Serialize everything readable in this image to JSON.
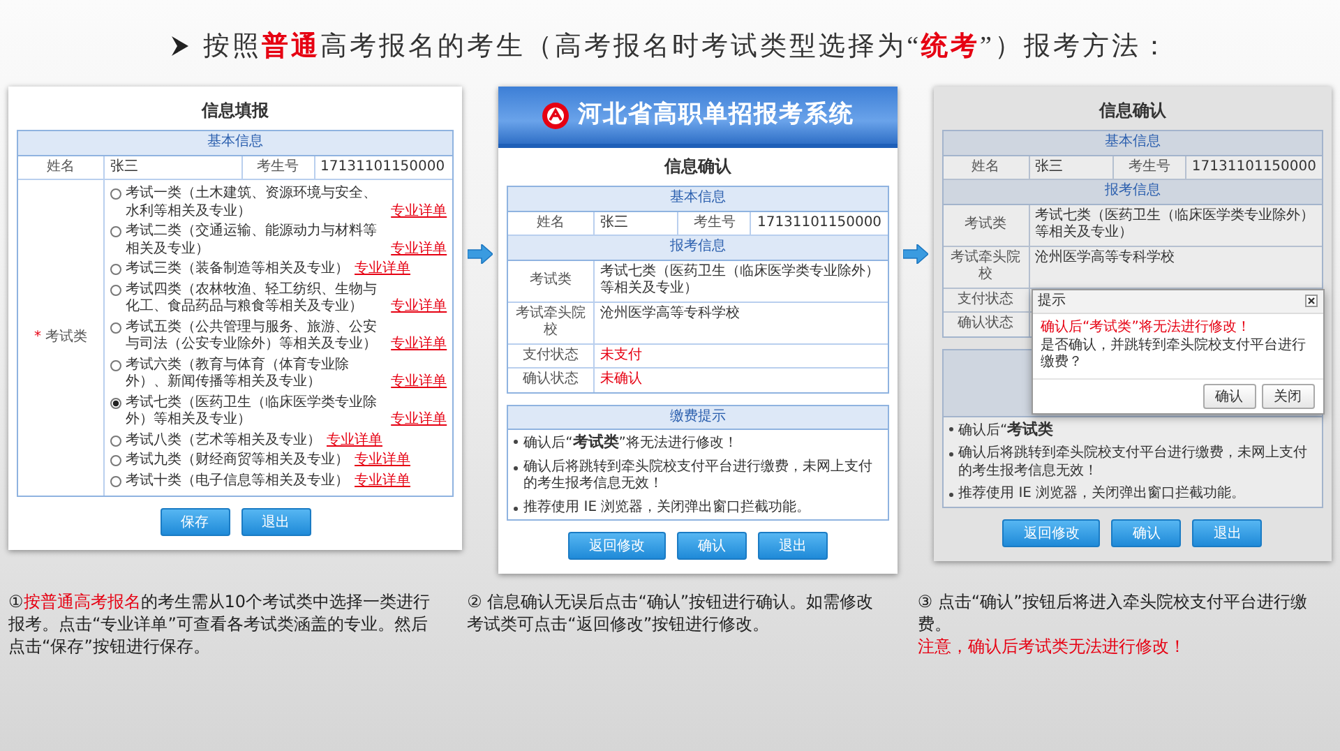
{
  "heading": {
    "segments": [
      {
        "text": "按照",
        "emphasis": false
      },
      {
        "text": "普通",
        "emphasis": true
      },
      {
        "text": "高考报名的考生（高考报名时考试类型选择为“",
        "emphasis": false
      },
      {
        "text": "统考",
        "emphasis": true
      },
      {
        "text": "”）报考方法：",
        "emphasis": false
      }
    ]
  },
  "form_panel": {
    "title": "信息填报",
    "basic_header": "基本信息",
    "name_label": "姓名",
    "name": "张三",
    "id_label": "考生号",
    "id": "17131101150000",
    "required_mark": "*",
    "class_label": "考试类",
    "options": [
      {
        "label": "考试一类（土木建筑、资源环境与安全、水利等相关及专业）",
        "link": "专业详单",
        "selected": false
      },
      {
        "label": "考试二类（交通运输、能源动力与材料等相关及专业）",
        "link": "专业详单",
        "selected": false
      },
      {
        "label": "考试三类（装备制造等相关及专业）",
        "link": "专业详单",
        "selected": false
      },
      {
        "label": "考试四类（农林牧渔、轻工纺织、生物与化工、食品药品与粮食等相关及专业）",
        "link": "专业详单",
        "selected": false
      },
      {
        "label": "考试五类（公共管理与服务、旅游、公安与司法（公安专业除外）等相关及专业）",
        "link": "专业详单",
        "selected": false
      },
      {
        "label": "考试六类（教育与体育（体育专业除外）、新闻传播等相关及专业）",
        "link": "专业详单",
        "selected": false
      },
      {
        "label": "考试七类（医药卫生（临床医学类专业除外）等相关及专业）",
        "link": "专业详单",
        "selected": true
      },
      {
        "label": "考试八类（艺术等相关及专业）",
        "link": "专业详单",
        "selected": false
      },
      {
        "label": "考试九类（财经商贸等相关及专业）",
        "link": "专业详单",
        "selected": false
      },
      {
        "label": "考试十类（电子信息等相关及专业）",
        "link": "专业详单",
        "selected": false
      }
    ],
    "buttons": [
      "保存",
      "退出"
    ]
  },
  "confirm_panel": {
    "banner": "河北省高职单招报考系统",
    "title": "信息确认",
    "basic_header": "基本信息",
    "name_label": "姓名",
    "name": "张三",
    "id_label": "考生号",
    "id": "17131101150000",
    "apply_header": "报考信息",
    "rows": [
      {
        "label": "考试类",
        "value": "考试七类（医药卫生（临床医学类专业除外）等相关及专业）",
        "highlight": false
      },
      {
        "label": "考试牵头院校",
        "value": "沧州医学高等专科学校",
        "highlight": false
      },
      {
        "label": "支付状态",
        "value": "未支付",
        "highlight": true
      },
      {
        "label": "确认状态",
        "value": "未确认",
        "highlight": true
      }
    ],
    "notes_header": "缴费提示",
    "notes": [
      "确认后“**考试类**”将无法进行修改！",
      "确认后将跳转到牵头院校支付平台进行缴费，未网上支付的考生报考信息无效！",
      "推荐使用 IE 浏览器，关闭弹出窗口拦截功能。"
    ],
    "buttons": [
      "返回修改",
      "确认",
      "退出"
    ]
  },
  "payment_panel": {
    "title": "信息确认",
    "basic_header": "基本信息",
    "name_label": "姓名",
    "name": "张三",
    "id_label": "考生号",
    "id": "17131101150000",
    "apply_header": "报考信息",
    "rows": [
      {
        "label": "考试类",
        "value": "考试七类（医药卫生（临床医学类专业除外）等相关及专业）"
      },
      {
        "label": "考试牵头院校",
        "value": "沧州医学高等专科学校"
      },
      {
        "label": "支付状态"
      },
      {
        "label": "确认状态"
      }
    ],
    "notes": [
      "确认后“**考试类**",
      "确认后将跳转到牵头院校支付平台进行缴费，未网上支付的考生报考信息无效！",
      "推荐使用 IE 浏览器，关闭弹出窗口拦截功能。"
    ],
    "buttons": [
      "返回修改",
      "确认",
      "退出"
    ],
    "dialog": {
      "title": "提示",
      "warning": "确认后“考试类”将无法进行修改！",
      "question": "是否确认，并跳转到牵头院校支付平台进行缴费？",
      "buttons": [
        "确认",
        "关闭"
      ]
    }
  },
  "captions": [
    {
      "paragraphs": [
        [
          {
            "text": "①",
            "emphasis": false
          },
          {
            "text": "按普通高考报名",
            "emphasis": true
          },
          {
            "text": "的考生需从10个考试类中选择一类进行报考。点击“专业详单”可查看各考试类涵盖的专业。然后点击“保存”按钮进行保存。",
            "emphasis": false
          }
        ]
      ]
    },
    {
      "paragraphs": [
        [
          {
            "text": "② 信息确认无误后点击“确认”按钮进行确认。如需修改考试类可点击“返回修改”按钮进行修改。",
            "emphasis": false
          }
        ]
      ]
    },
    {
      "paragraphs": [
        [
          {
            "text": "③ 点击“确认”按钮后将进入牵头院校支付平台进行缴费。",
            "emphasis": false
          }
        ],
        [
          {
            "text": "注意，确认后考试类无法进行修改！",
            "emphasis": true
          }
        ]
      ]
    }
  ]
}
